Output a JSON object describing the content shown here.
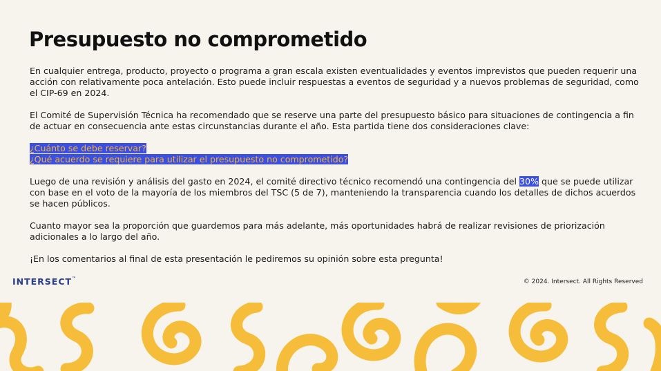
{
  "slide": {
    "title": "Presupuesto no comprometido",
    "paragraph1": "En cualquier entrega, producto, proyecto o programa a gran escala existen eventualidades y eventos imprevistos que pueden requerir una acción con relativamente poca antelación. Esto puede incluir respuestas a eventos de seguridad y a nuevos problemas de seguridad, como el CIP-69 en 2024.",
    "paragraph2": "El Comité de Supervisión Técnica ha recomendado que se reserve una parte del presupuesto básico para situaciones de contingencia a fin de actuar en consecuencia ante estas circunstancias durante el año. Esta partida tiene dos consideraciones clave:",
    "question1": "¿Cuánto se debe reservar?",
    "question2": "¿Qué acuerdo se requiere para utilizar el presupuesto no comprometido?",
    "paragraph3_before": "Luego de una revisión y análisis del gasto en 2024, el comité directivo técnico recomendó una contingencia del ",
    "paragraph3_highlight": "30%",
    "paragraph3_after": " que se puede utilizar con base en el voto de la mayoría de los miembros del TSC (5 de 7), manteniendo la transparencia cuando los detalles de dichos acuerdos se hacen públicos.",
    "paragraph4": "Cuanto mayor sea la proporción que guardemos para más adelante, más oportunidades habrá de realizar revisiones de priorización adicionales a lo largo del año.",
    "paragraph5": "¡En los comentarios al final de esta presentación le pediremos su opinión sobre esta pregunta!"
  },
  "footer": {
    "logo": "INTERSECT",
    "logo_tm": "™",
    "copyright": "© 2024. Intersect. All Rights Reserved"
  },
  "colors": {
    "background": "#f7f4ee",
    "highlight_bg": "#3b4fe0",
    "highlight_text": "#f2b53b",
    "pattern": "#f5bd3a",
    "logo": "#2a3e8c"
  }
}
